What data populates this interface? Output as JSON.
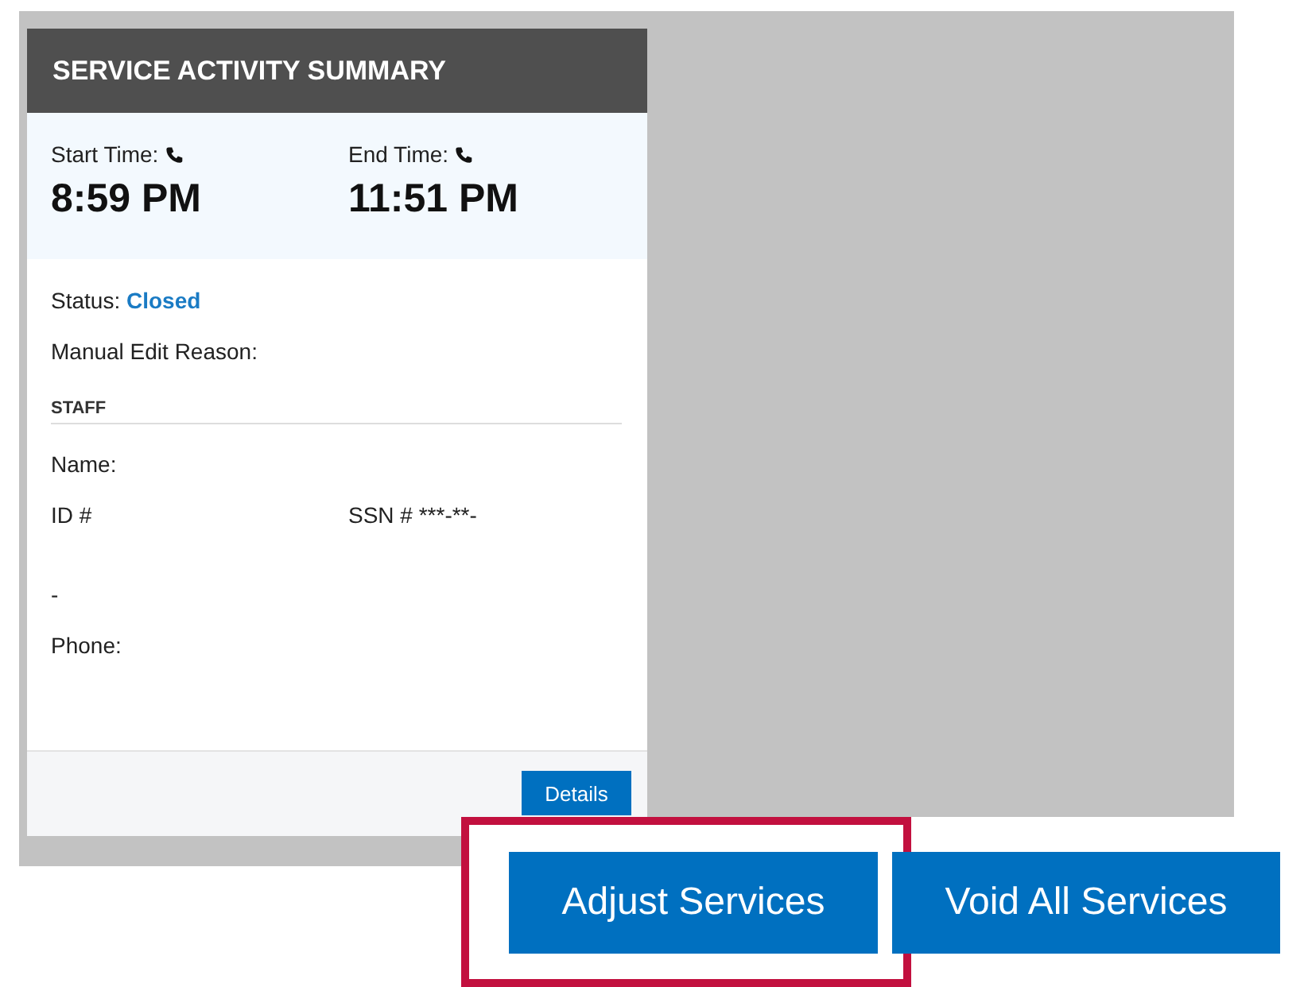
{
  "card": {
    "title": "SERVICE ACTIVITY SUMMARY",
    "times": [
      {
        "label": "Start Time:",
        "value": "8:59 PM"
      },
      {
        "label": "End Time:",
        "value": "11:51 PM"
      }
    ],
    "status": {
      "label": "Status:",
      "value": "Closed"
    },
    "manual_edit_reason": {
      "label": "Manual Edit Reason:"
    },
    "section": "STAFF",
    "name": {
      "label": "Name:"
    },
    "id": {
      "label": "ID #"
    },
    "ssn": {
      "label": "SSN # ***-**-"
    },
    "line_4": "-",
    "phone": {
      "label": "Phone:"
    },
    "details_button": "Details"
  },
  "actions": [
    {
      "label": "Adjust Services",
      "highlighted": true
    },
    {
      "label": "Void All Services",
      "highlighted": false
    }
  ]
}
